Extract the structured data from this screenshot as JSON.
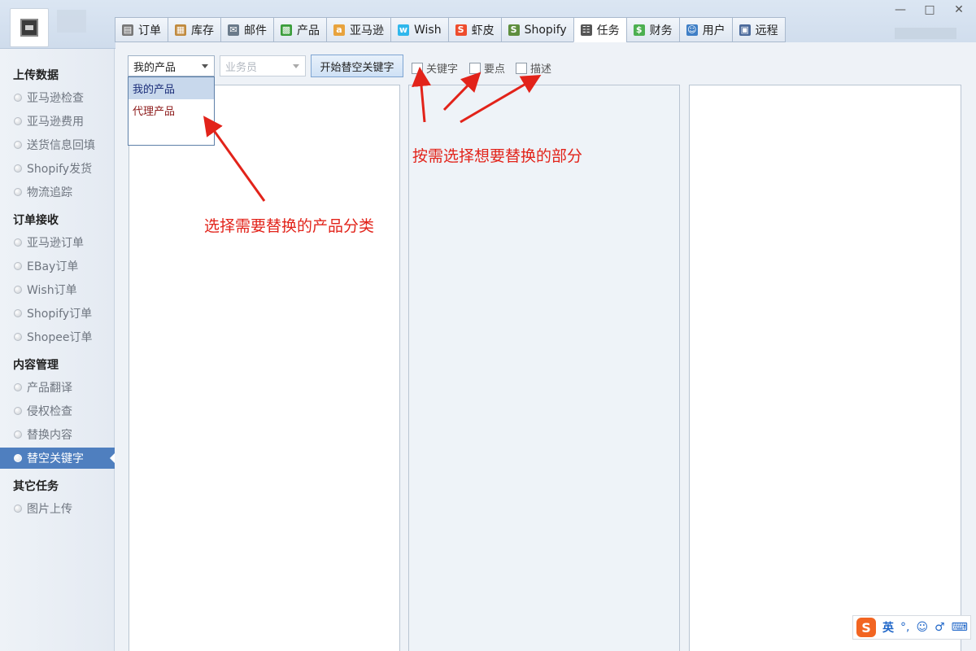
{
  "window": {
    "minimize_glyph": "—",
    "maximize_glyph": "□",
    "close_glyph": "✕"
  },
  "tabs": [
    {
      "label": "订单",
      "icon": "clipboard-icon",
      "glyph": "▤",
      "color": "#777777"
    },
    {
      "label": "库存",
      "icon": "box-icon",
      "glyph": "▦",
      "color": "#c08a3e"
    },
    {
      "label": "邮件",
      "icon": "mail-icon",
      "glyph": "✉",
      "color": "#6a7a8a"
    },
    {
      "label": "产品",
      "icon": "grid-icon",
      "glyph": "▩",
      "color": "#3a9d3a"
    },
    {
      "label": "亚马逊",
      "icon": "amazon-icon",
      "glyph": "a",
      "color": "#e8a33d"
    },
    {
      "label": "Wish",
      "icon": "wish-icon",
      "glyph": "w",
      "color": "#2fb7ec"
    },
    {
      "label": "虾皮",
      "icon": "shopee-icon",
      "glyph": "S",
      "color": "#ee4d2d"
    },
    {
      "label": "Shopify",
      "icon": "shopify-icon",
      "glyph": "S",
      "color": "#5e8e3e"
    },
    {
      "label": "任务",
      "icon": "task-icon",
      "glyph": "☷",
      "color": "#555555"
    },
    {
      "label": "财务",
      "icon": "money-icon",
      "glyph": "$",
      "color": "#4caf50"
    },
    {
      "label": "用户",
      "icon": "user-icon",
      "glyph": "☺",
      "color": "#3f7fc6"
    },
    {
      "label": "远程",
      "icon": "remote-desktop-icon",
      "glyph": "▣",
      "color": "#4b6a9b"
    }
  ],
  "active_tab_index": 8,
  "sidebar": {
    "sections": [
      {
        "title": "上传数据",
        "items": [
          "亚马逊检查",
          "亚马逊费用",
          "送货信息回填",
          "Shopify发货",
          "物流追踪"
        ]
      },
      {
        "title": "订单接收",
        "items": [
          "亚马逊订单",
          "EBay订单",
          "Wish订单",
          "Shopify订单",
          "Shopee订单"
        ]
      },
      {
        "title": "内容管理",
        "items": [
          "产品翻译",
          "侵权检查",
          "替换内容",
          "替空关键字"
        ]
      },
      {
        "title": "其它任务",
        "items": [
          "图片上传"
        ]
      }
    ],
    "active_item": "替空关键字"
  },
  "toolbar": {
    "product_select_value": "我的产品",
    "staff_select_placeholder": "业务员",
    "start_button": "开始替空关键字",
    "checkboxes": [
      {
        "label": "关键字",
        "checked": false
      },
      {
        "label": "要点",
        "checked": false
      },
      {
        "label": "描述",
        "checked": false
      }
    ]
  },
  "dropdown": {
    "options": [
      "我的产品",
      "代理产品"
    ],
    "selected": "我的产品"
  },
  "annotations": {
    "product_category": "选择需要替换的产品分类",
    "replace_parts": "按需选择想要替换的部分",
    "color": "#e2231a"
  },
  "ime": {
    "logo": "S",
    "mode": "英",
    "punct_glyph": "°,",
    "emoji_glyph": "☺",
    "mic_glyph": "♂",
    "keyboard_glyph": "⌨"
  }
}
